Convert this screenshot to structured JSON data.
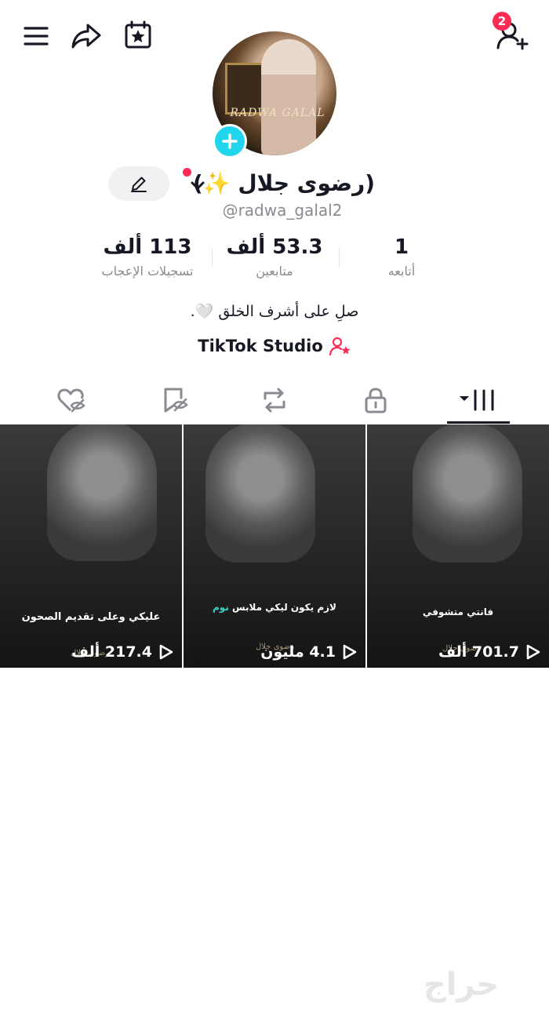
{
  "header": {
    "notification_count": "2"
  },
  "profile": {
    "display_name": "(رضوى جلال ✨)",
    "username": "@radwa_galal2",
    "avatar_text": "RADWA GALAL"
  },
  "stats": {
    "likes": {
      "value": "113 ألف",
      "label": "تسجيلات الإعجاب"
    },
    "followers": {
      "value": "53.3 ألف",
      "label": "متابعين"
    },
    "following": {
      "value": "1",
      "label": "أتابعه"
    }
  },
  "bio": "صلِ على أشرف الخلق 🤍.",
  "studio_link": "TikTok Studio",
  "tabs": [
    {
      "icon": "videos-grid-icon",
      "active": true
    },
    {
      "icon": "lock-icon",
      "active": false
    },
    {
      "icon": "repost-icon",
      "active": false
    },
    {
      "icon": "favorites-icon",
      "active": false
    },
    {
      "icon": "liked-hidden-icon",
      "active": false
    }
  ],
  "videos": [
    {
      "caption_pre": "",
      "caption": "فانتي متشوفي",
      "caption_hl": "",
      "views": "701.7 ألف",
      "watermark": "رضوى جلال"
    },
    {
      "caption_pre": "لازم يكون ليكي ملابس ",
      "caption": "",
      "caption_hl": "نوم",
      "views": "4.1 مليون",
      "watermark": "رضوى جلال"
    },
    {
      "caption_pre": "",
      "caption": "عليكي وعلى تقديم الصحون",
      "caption_hl": "",
      "views": "217.4 ألف",
      "watermark": "رضوى جلال"
    }
  ],
  "footer_watermark": "حراج",
  "colors": {
    "accent_red": "#fe2c55",
    "accent_cyan": "#20d5ec",
    "text_primary": "#161823",
    "text_secondary": "#8a8b91"
  }
}
